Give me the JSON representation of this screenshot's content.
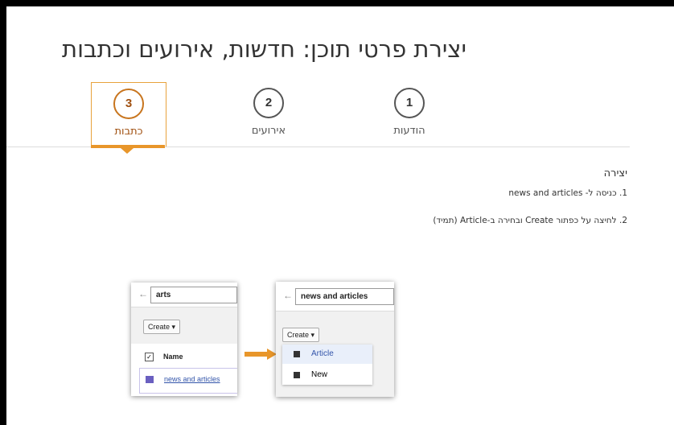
{
  "page": {
    "title": "יצירת פרטי תוכן: חדשות, אירועים וכתבות"
  },
  "steps": [
    {
      "number": "1",
      "label": "הודעות"
    },
    {
      "number": "2",
      "label": "אירועים"
    },
    {
      "number": "3",
      "label": "כתבות",
      "active": true
    }
  ],
  "content": {
    "heading": "יצירה",
    "line1": "1. כניסה ל- news and articles",
    "line2": "2. לחיצה על כפתור Create ובחירה ב-Article (תמיד)"
  },
  "screenshot_left": {
    "back_glyph": "←",
    "search_value": "arts",
    "create_label": "Create ▾",
    "check_glyph": "✓",
    "column_header": "Name",
    "result": "news and articles"
  },
  "screenshot_right": {
    "back_glyph": "←",
    "search_value": "news and articles",
    "create_label": "Create ▾",
    "menu": [
      "Article",
      "New"
    ]
  },
  "colors": {
    "accent": "#e8962a",
    "active_text": "#a05010",
    "link": "#3355aa"
  }
}
